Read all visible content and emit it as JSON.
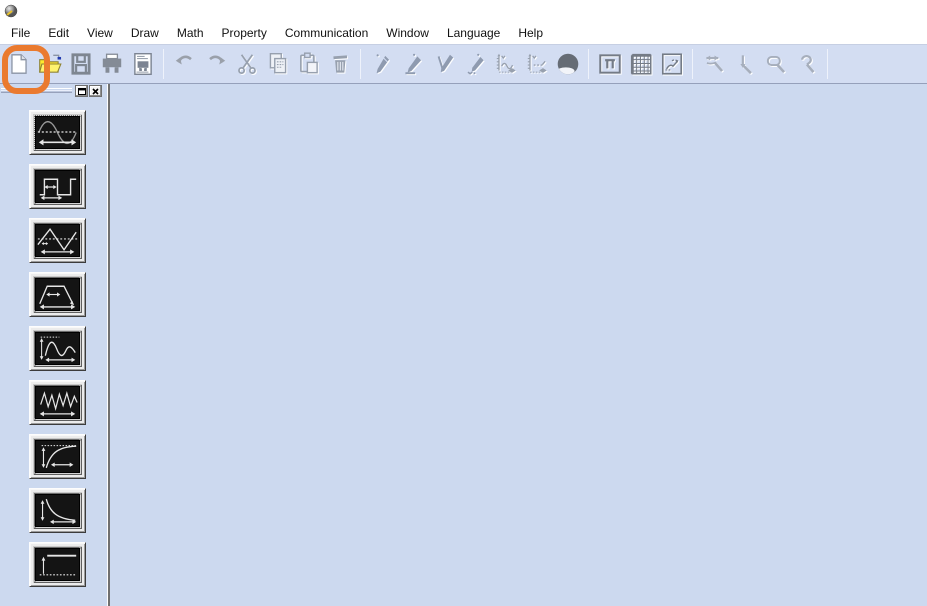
{
  "app": {
    "icon": "globe-pencil-app-icon"
  },
  "menubar": {
    "items": [
      {
        "label": "File"
      },
      {
        "label": "Edit"
      },
      {
        "label": "View"
      },
      {
        "label": "Draw"
      },
      {
        "label": "Math"
      },
      {
        "label": "Property"
      },
      {
        "label": "Communication"
      },
      {
        "label": "Window"
      },
      {
        "label": "Language"
      },
      {
        "label": "Help"
      }
    ]
  },
  "toolbar": {
    "buttons": [
      {
        "name": "new-file"
      },
      {
        "name": "open-file"
      },
      {
        "name": "save-file"
      },
      {
        "name": "print"
      },
      {
        "name": "print-preview"
      },
      {
        "name": "undo"
      },
      {
        "name": "redo"
      },
      {
        "name": "cut"
      },
      {
        "name": "copy"
      },
      {
        "name": "paste"
      },
      {
        "name": "delete"
      },
      {
        "name": "draw-line"
      },
      {
        "name": "draw-freehand"
      },
      {
        "name": "draw-polyline"
      },
      {
        "name": "draw-points"
      },
      {
        "name": "edit-horizontal-axis"
      },
      {
        "name": "edit-vertical-axis"
      },
      {
        "name": "draw-ellipse"
      },
      {
        "name": "marker"
      },
      {
        "name": "grid"
      },
      {
        "name": "graph-setup"
      },
      {
        "name": "zoom-horizontal"
      },
      {
        "name": "zoom-vertical"
      },
      {
        "name": "zoom-out"
      },
      {
        "name": "zoom-undo"
      }
    ]
  },
  "dock": {
    "controls": [
      {
        "name": "expand-panel"
      },
      {
        "name": "close-panel"
      }
    ]
  },
  "sidebar": {
    "buttons": [
      {
        "name": "sine-wave"
      },
      {
        "name": "square-wave"
      },
      {
        "name": "triangle-wave"
      },
      {
        "name": "trapezoid-wave"
      },
      {
        "name": "gaussian-wave"
      },
      {
        "name": "noise-wave"
      },
      {
        "name": "exponential-rise-wave"
      },
      {
        "name": "exponential-decay-wave"
      },
      {
        "name": "dc-level-wave"
      }
    ]
  },
  "annotation": {
    "shape": "rounded-rectangle",
    "color": "#EA7A2F",
    "target": "new-file-button"
  },
  "colors": {
    "toolbar_bg": "#d3ddf2",
    "canvas_bg": "#ccd9ef",
    "annotation": "#EA7A2F"
  }
}
